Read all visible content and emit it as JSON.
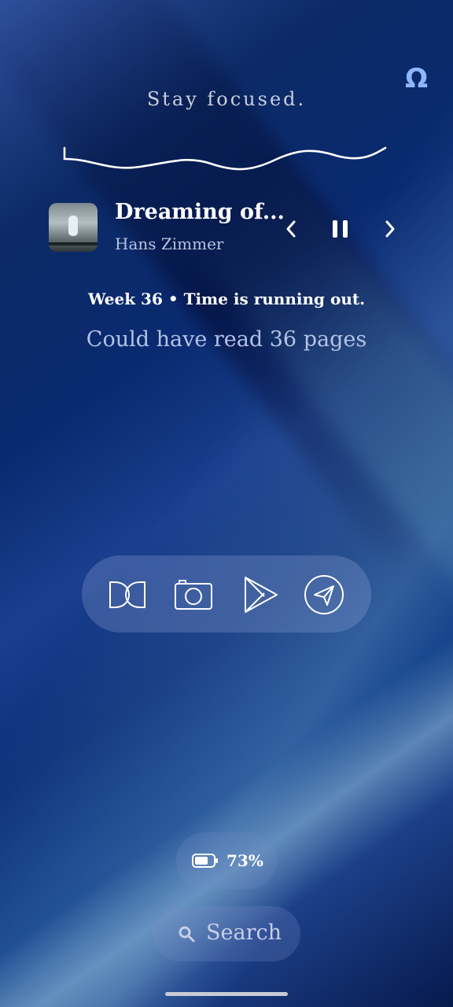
{
  "header": {
    "motto": "Stay focused.",
    "top_right_icon": "omega-icon"
  },
  "media": {
    "track_title": "Dreaming of...",
    "artist": "Hans Zimmer",
    "controls": [
      "previous-icon",
      "pause-icon",
      "next-icon"
    ]
  },
  "reminder": {
    "week_text": "Week 36 • Time is running out.",
    "reading_text": "Could have read 36 pages"
  },
  "dock": {
    "apps": [
      "dolby-icon",
      "camera-icon",
      "play-store-icon",
      "telegram-icon"
    ]
  },
  "status": {
    "battery_percent": "73%",
    "battery_level": 0.73
  },
  "search": {
    "label": "Search",
    "icon": "search-icon"
  },
  "colors": {
    "accent": "#8fb6ff",
    "text_muted": "#b3c3e6"
  }
}
